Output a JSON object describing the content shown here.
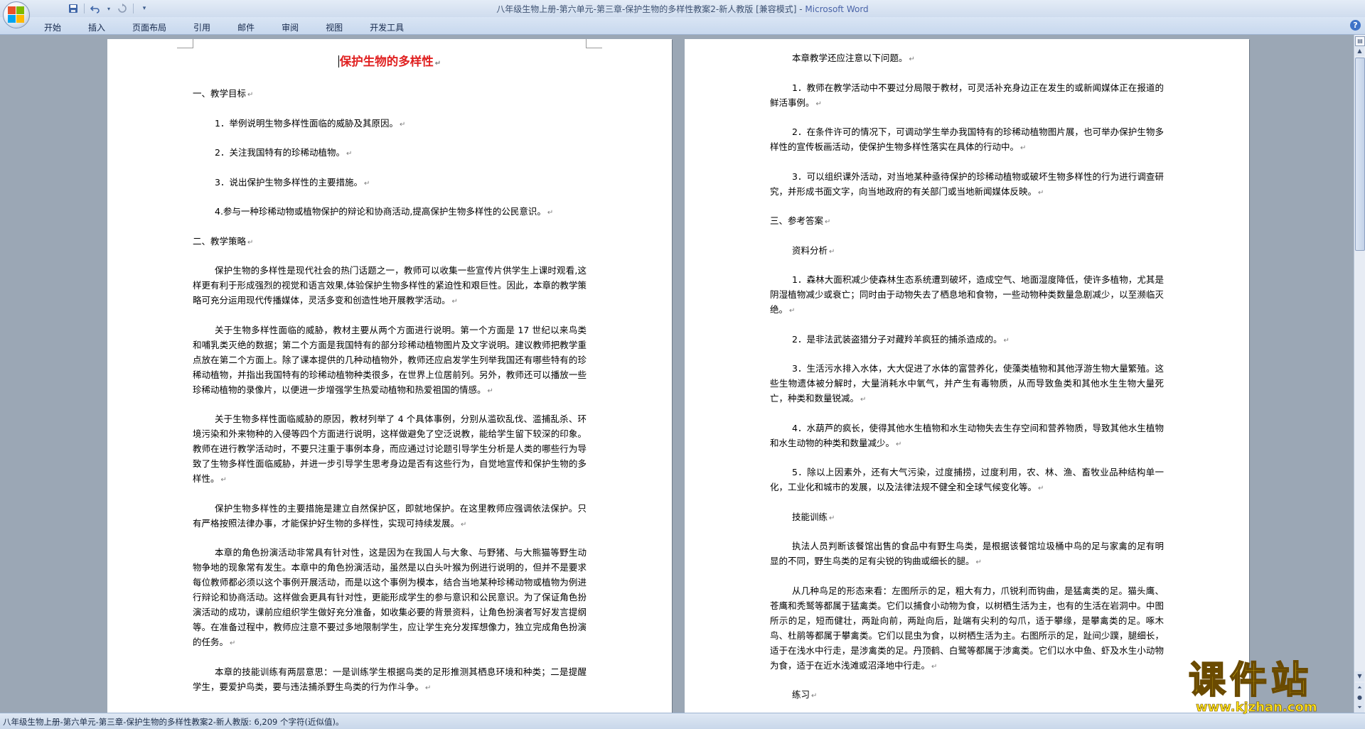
{
  "window": {
    "title": "八年级生物上册-第六单元-第三章-保护生物的多样性教案2-新人教版 [兼容模式] - ",
    "app_name": "Microsoft Word"
  },
  "quick_access": {
    "save_icon": "save-icon",
    "undo_icon": "undo-icon",
    "redo_icon": "redo-icon",
    "customize_icon": "customize-qat-icon"
  },
  "ribbon": {
    "tabs": [
      "开始",
      "插入",
      "页面布局",
      "引用",
      "邮件",
      "审阅",
      "视图",
      "开发工具"
    ],
    "help_label": "?"
  },
  "document": {
    "title": "保护生物的多样性",
    "left_page": [
      {
        "style": "head",
        "text": "一、教学目标"
      },
      {
        "style": "indent",
        "text": "1．举例说明生物多样性面临的威胁及其原因。"
      },
      {
        "style": "indent",
        "text": "2．关注我国特有的珍稀动植物。"
      },
      {
        "style": "indent",
        "text": "3．说出保护生物多样性的主要措施。"
      },
      {
        "style": "indent",
        "text": "4.参与一种珍稀动物或植物保护的辩论和协商活动,提高保护生物多样性的公民意识。"
      },
      {
        "style": "head",
        "text": "二、教学策略"
      },
      {
        "style": "indent",
        "text": "保护生物的多样性是现代社会的热门话题之一，教师可以收集一些宣传片供学生上课时观看,这样更有利于形成强烈的视觉和语言效果,体验保护生物多样性的紧迫性和艰巨性。因此，本章的教学策略可充分运用现代传播媒体，灵活多变和创造性地开展教学活动。"
      },
      {
        "style": "indent",
        "text": "关于生物多样性面临的威胁，教材主要从两个方面进行说明。第一个方面是 17 世纪以来鸟类和哺乳类灭绝的数据；第二个方面是我国特有的部分珍稀动植物图片及文字说明。建议教师把教学重点放在第二个方面上。除了课本提供的几种动植物外，教师还应启发学生列举我国还有哪些特有的珍稀动植物，并指出我国特有的珍稀动植物种类很多，在世界上位居前列。另外，教师还可以播放一些珍稀动植物的录像片，以便进一步增强学生热爱动植物和热爱祖国的情感。"
      },
      {
        "style": "indent",
        "text": "关于生物多样性面临威胁的原因，教材列举了 4 个具体事例，分别从滥砍乱伐、滥捕乱杀、环境污染和外来物种的入侵等四个方面进行说明，这样做避免了空泛说教，能给学生留下较深的印象。教师在进行教学活动时，不要只注重于事例本身，而应通过讨论题引导学生分析是人类的哪些行为导致了生物多样性面临威胁，并进一步引导学生思考身边是否有这些行为，自觉地宣传和保护生物的多样性。"
      },
      {
        "style": "indent",
        "text": "保护生物多样性的主要措施是建立自然保护区，即就地保护。在这里教师应强调依法保护。只有严格按照法律办事，才能保护好生物的多样性，实现可持续发展。"
      },
      {
        "style": "indent",
        "text": "本章的角色扮演活动非常具有针对性，这是因为在我国人与大象、与野猪、与大熊猫等野生动物争地的现象常有发生。本章中的角色扮演活动，虽然是以白头叶猴为例进行说明的，但并不是要求每位教师都必须以这个事例开展活动，而是以这个事例为模本，结合当地某种珍稀动物或植物为例进行辩论和协商活动。这样做会更具有针对性，更能形成学生的参与意识和公民意识。为了保证角色扮演活动的成功，课前应组织学生做好充分准备，如收集必要的背景资料，让角色扮演者写好发言提纲等。在准备过程中，教师应注意不要过多地限制学生，应让学生充分发挥想像力，独立完成角色扮演的任务。"
      },
      {
        "style": "indent",
        "text": "本章的技能训练有两层意思：一是训练学生根据鸟类的足形推测其栖息环境和种类；二是提醒学生，要爱护鸟类，要与违法捕杀野生鸟类的行为作斗争。"
      }
    ],
    "right_page": [
      {
        "style": "indent",
        "text": "本章教学还应注意以下问题。"
      },
      {
        "style": "indent",
        "text": "1．教师在教学活动中不要过分局限于教材，可灵活补充身边正在发生的或新闻媒体正在报道的鲜活事例。"
      },
      {
        "style": "indent",
        "text": "2．在条件许可的情况下，可调动学生举办我国特有的珍稀动植物图片展，也可举办保护生物多样性的宣传板画活动，使保护生物多样性落实在具体的行动中。"
      },
      {
        "style": "indent",
        "text": "3．可以组织课外活动，对当地某种亟待保护的珍稀动植物或破坏生物多样性的行为进行调查研究，并形成书面文字，向当地政府的有关部门或当地新闻媒体反映。"
      },
      {
        "style": "head",
        "text": "三、参考答案"
      },
      {
        "style": "indent",
        "text": "资料分析"
      },
      {
        "style": "indent",
        "text": "1．森林大面积减少使森林生态系统遭到破坏，造成空气、地面湿度降低，使许多植物，尤其是阴湿植物减少或衰亡；同时由于动物失去了栖息地和食物，一些动物种类数量急剧减少，以至濒临灭绝。"
      },
      {
        "style": "indent",
        "text": "2．是非法武装盗猎分子对藏羚羊疯狂的捕杀造成的。"
      },
      {
        "style": "indent",
        "text": "3．生活污水排入水体，大大促进了水体的富营养化，使藻类植物和其他浮游生物大量繁殖。这些生物遗体被分解时，大量消耗水中氧气，并产生有毒物质，从而导致鱼类和其他水生生物大量死亡，种类和数量锐减。"
      },
      {
        "style": "indent",
        "text": "4．水葫芦的疯长，使得其他水生植物和水生动物失去生存空间和营养物质，导致其他水生植物和水生动物的种类和数量减少。"
      },
      {
        "style": "indent",
        "text": "5．除以上因素外，还有大气污染，过度捕捞，过度利用，农、林、渔、畜牧业品种结构单一化，工业化和城市的发展，以及法律法规不健全和全球气候变化等。"
      },
      {
        "style": "indent",
        "text": "技能训练"
      },
      {
        "style": "indent",
        "text": "执法人员判断该餐馆出售的食品中有野生鸟类，是根据该餐馆垃圾桶中鸟的足与家禽的足有明显的不同，野生鸟类的足有尖锐的钩曲或细长的腿。"
      },
      {
        "style": "indent",
        "text": "从几种鸟足的形态来看：左图所示的足，粗大有力，爪锐利而钩曲，是猛禽类的足。猫头鹰、苍鹰和秃鹫等都属于猛禽类。它们以捕食小动物为食，以树栖生活为主，也有的生活在岩洞中。中图所示的足，短而健壮，两趾向前，两趾向后，趾端有尖利的勾爪，适于攀缘，是攀禽类的足。啄木鸟、杜鹃等都属于攀禽类。它们以昆虫为食，以树栖生活为主。右图所示的足，趾间少蹼，腿细长，适于在浅水中行走，是涉禽类的足。丹顶鹤、白鹭等都属于涉禽类。它们以水中鱼、虾及水生小动物为食，适于在近水浅滩或沼泽地中行走。"
      },
      {
        "style": "indent",
        "text": "练习"
      }
    ]
  },
  "status_bar": {
    "text": "八年级生物上册-第六单元-第三章-保护生物的多样性教案2-新人教版: 6,209 个字符(近似值)。"
  },
  "watermark": {
    "main": "课件站",
    "url": "www.kjzhan.com"
  },
  "colors": {
    "title_red": "#e02020",
    "ribbon_blue": "#c8d8ee",
    "watermark_yellow": "#ffe21a"
  }
}
